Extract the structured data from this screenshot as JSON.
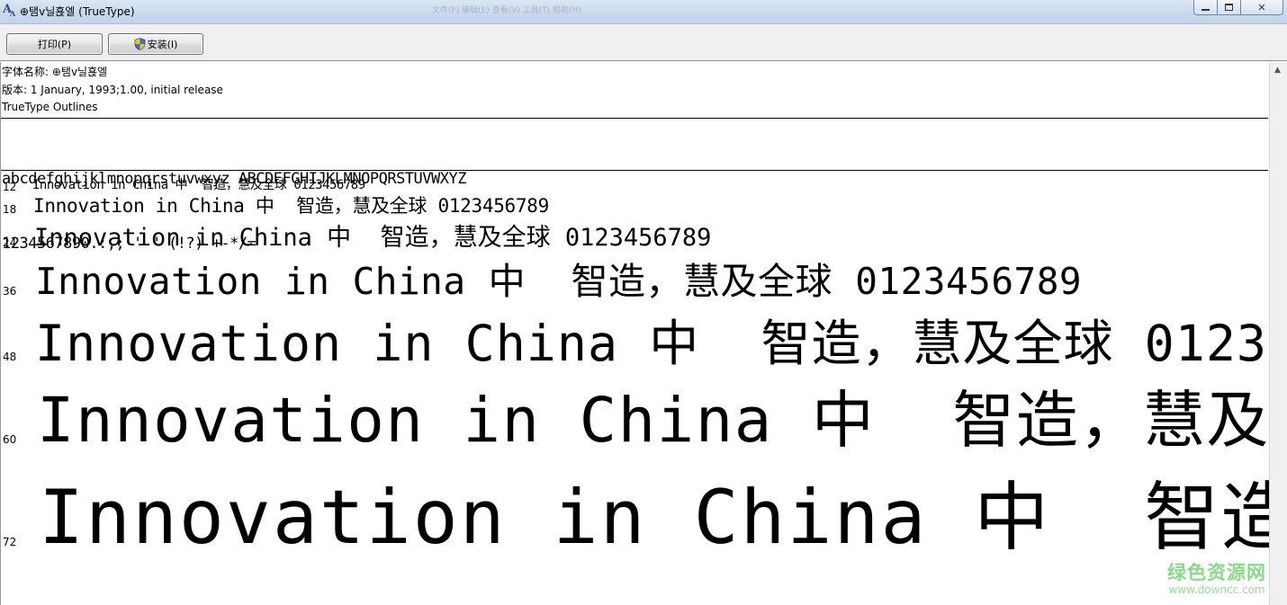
{
  "window": {
    "title": "⊕탬ⅴ닐횭엘 (TrueType)",
    "background_blur": "文件(F)   编辑(E)   查看(V)   工具(T)   帮助(H)",
    "icon": "font-icon",
    "min_label": "",
    "max_label": "",
    "close_label": "✕"
  },
  "toolbar": {
    "print_label": "打印(P)",
    "install_label": "安装(I)",
    "install_icon": "uac-shield-icon"
  },
  "font_info": {
    "name_line": "字体名称: ⊕탬ⅴ닐횭엘",
    "version_line": "版本: 1 January, 1993;1.00, initial release",
    "outline_line": "TrueType Outlines"
  },
  "charset": {
    "line1": "abcdefghijklmnopqrstuvwxyz ABCDEFGHIJKLMNOPQRSTUVWXYZ",
    "line2": "1234567890.:,; ' \" (!?) +-*/="
  },
  "samples": {
    "text": "Innovation in China 中  智造，慧及全球 0123456789",
    "rows": [
      {
        "size": "12"
      },
      {
        "size": "18"
      },
      {
        "size": "24"
      },
      {
        "size": "36"
      },
      {
        "size": "48"
      },
      {
        "size": "60"
      },
      {
        "size": "72"
      }
    ]
  },
  "watermark": {
    "main": "绿色资源网",
    "url": "www.downcc.com"
  },
  "colors": {
    "titlebar": "#c9d9ec",
    "toolbar": "#f0f0f0",
    "watermark": "#7fd37f"
  }
}
